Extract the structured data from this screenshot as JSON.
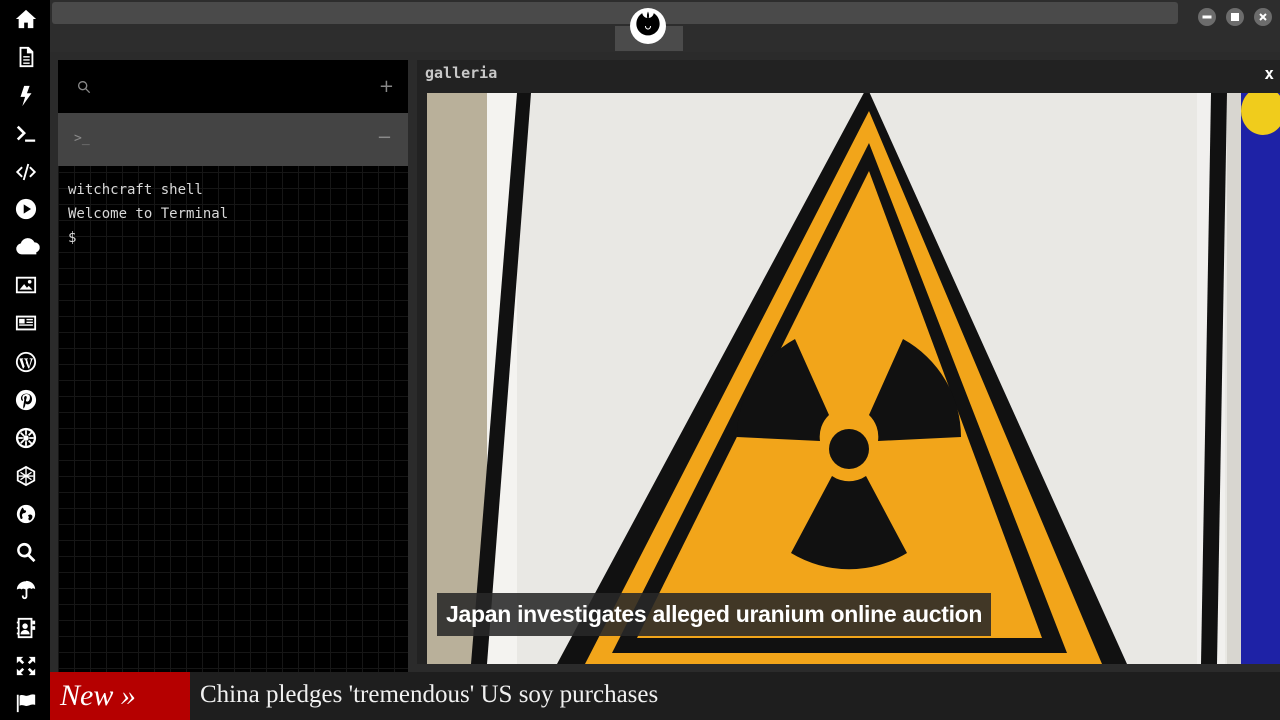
{
  "rail": {
    "icons": [
      "home-icon",
      "document-icon",
      "lightning-icon",
      "terminal-icon",
      "code-icon",
      "play-icon",
      "cloud-icon",
      "image-icon",
      "newspaper-icon",
      "wordpress-icon",
      "pinterest-icon",
      "galactic-republic-icon",
      "rebel-hex-icon",
      "globe-icon",
      "search-icon",
      "umbrella-icon",
      "contact-card-icon",
      "expand-icon",
      "flag-icon"
    ]
  },
  "topbar": {
    "logo_icon": "rebel-alliance-icon"
  },
  "window_controls": [
    "minimize-icon",
    "maximize-icon",
    "close-icon"
  ],
  "terminal": {
    "add_label": "+",
    "tab_prompt": ">_",
    "minimize_label": "−",
    "lines": [
      "witchcraft shell",
      "Welcome to Terminal",
      "$"
    ]
  },
  "galleria": {
    "title": "galleria",
    "close_label": "x",
    "caption": "Japan investigates alleged uranium online auction"
  },
  "ticker": {
    "badge": "New »",
    "headline": "China pledges 'tremendous' US soy purchases"
  },
  "colors": {
    "badge": "#b50000",
    "hazard_yellow": "#f2a51a",
    "panel_bg": "#000000"
  }
}
